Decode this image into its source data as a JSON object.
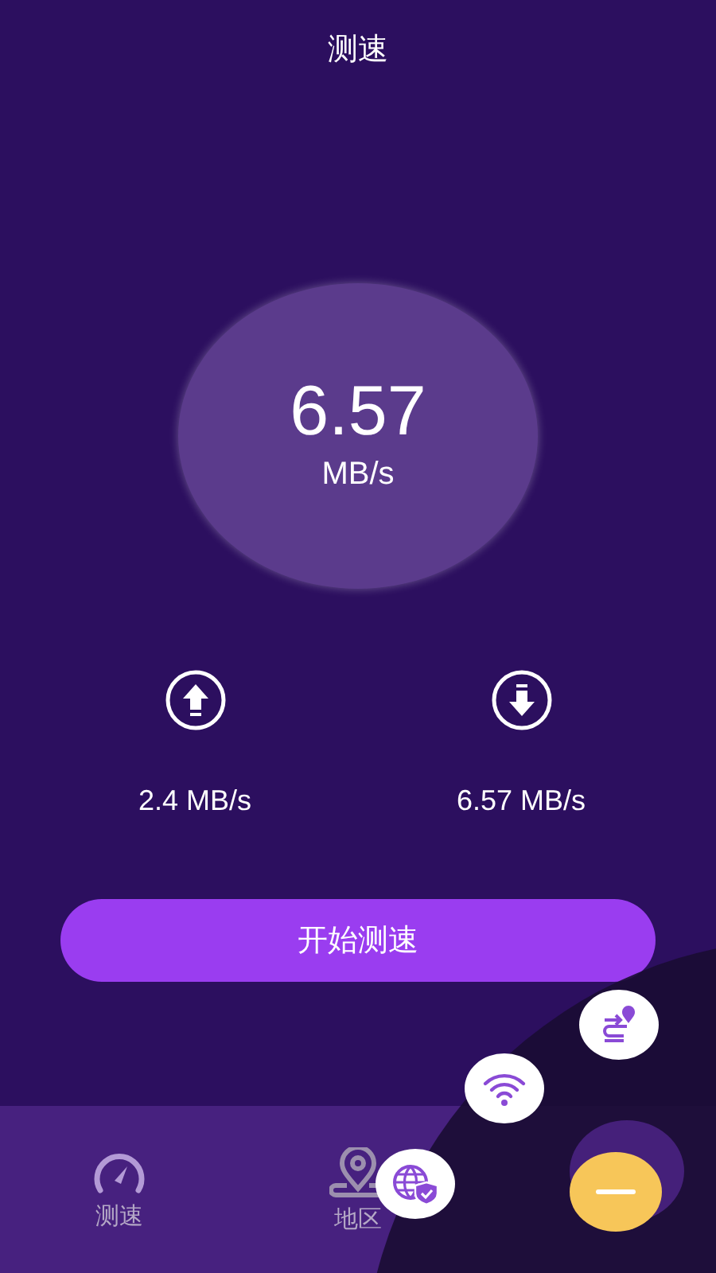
{
  "title": "测速",
  "speed": {
    "value": "6.57",
    "unit": "MB/s"
  },
  "stats": [
    {
      "kind": "upload",
      "reading": "2.4 MB/s"
    },
    {
      "kind": "download",
      "reading": "6.57 MB/s"
    }
  ],
  "start_button": "开始测速",
  "tabs": [
    {
      "kind": "gauge",
      "label": "测速"
    },
    {
      "kind": "pin",
      "label": "地区"
    }
  ],
  "fab_menu": {
    "expanded": true,
    "items": [
      {
        "kind": "route"
      },
      {
        "kind": "wifi"
      },
      {
        "kind": "globe"
      }
    ]
  }
}
